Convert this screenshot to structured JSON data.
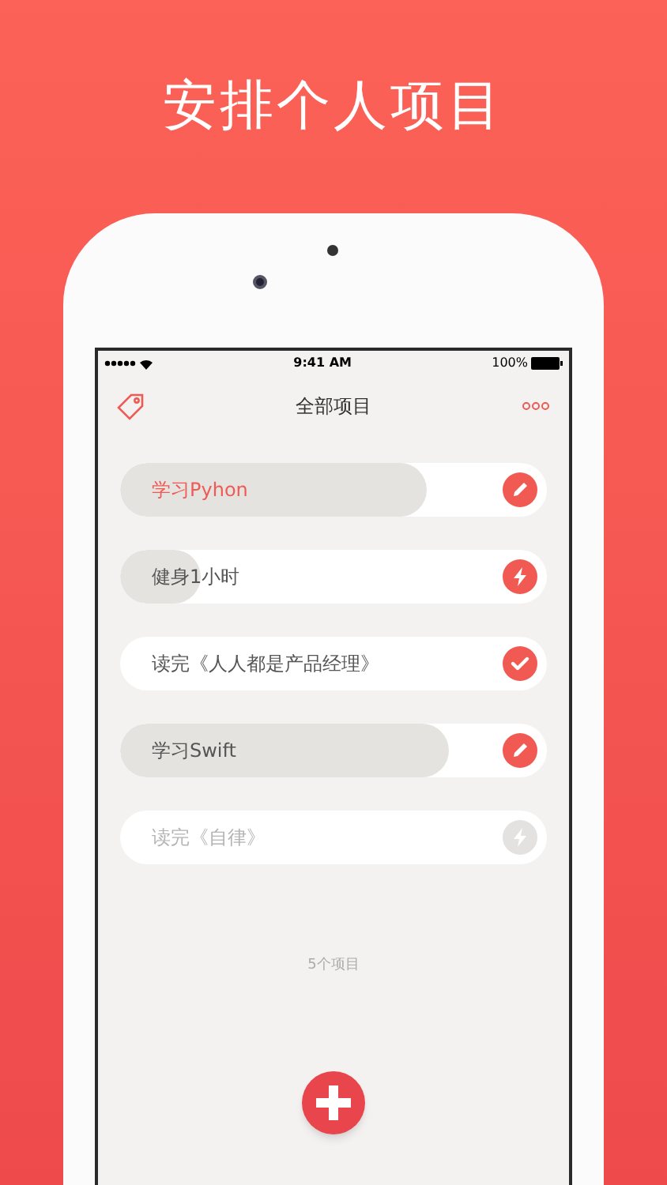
{
  "headline": "安排个人项目",
  "status_bar": {
    "time": "9:41 AM",
    "battery": "100%"
  },
  "nav": {
    "title": "全部项目"
  },
  "projects": [
    {
      "title": "学习Pyhon",
      "kind": "edit",
      "level": 0.72,
      "highlighted": true,
      "disabled": false
    },
    {
      "title": "健身1小时",
      "kind": "bolt",
      "level": 0.19,
      "highlighted": false,
      "disabled": false
    },
    {
      "title": "读完《人人都是产品经理》",
      "kind": "done",
      "highlighted": false,
      "disabled": false
    },
    {
      "title": "学习Swift",
      "kind": "edit",
      "level": 0.77,
      "highlighted": false,
      "disabled": false
    },
    {
      "title": "读完《自律》",
      "kind": "bolt",
      "highlighted": false,
      "disabled": true
    }
  ],
  "count": "5个项目"
}
